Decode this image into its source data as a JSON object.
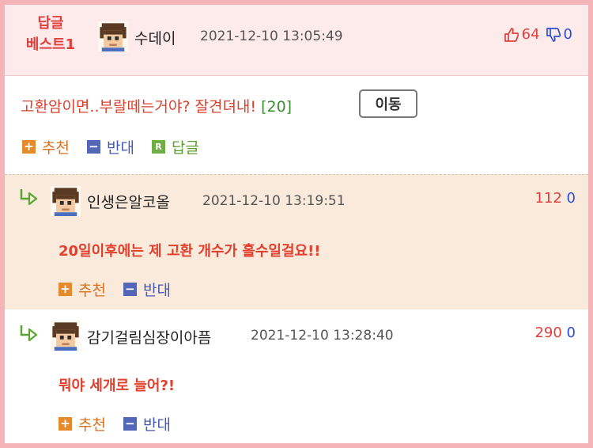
{
  "best": {
    "label_line1": "답글",
    "label_line2": "베스트1",
    "author": "수데이",
    "date": "2021-12-10 13:05:49",
    "upvotes": "64",
    "downvotes": "0",
    "content": "고환암이면..부랄떼는거야? 잘견뎌내! ",
    "reply_count": "[20]",
    "move_label": "이동",
    "recommend_label": "추천",
    "oppose_label": "반대",
    "reply_label": "답글"
  },
  "replies": [
    {
      "author": "인생은알코올",
      "date": "2021-12-10 13:19:51",
      "upvotes": "112",
      "downvotes": "0",
      "content": "20일이후에는 제 고환 개수가 홀수일걸요!!",
      "recommend_label": "추천",
      "oppose_label": "반대"
    },
    {
      "author": "감기걸림심장이아픔",
      "date": "2021-12-10 13:28:40",
      "upvotes": "290",
      "downvotes": "0",
      "content": "뭐야 세개로 늘어?!",
      "recommend_label": "추천",
      "oppose_label": "반대"
    }
  ],
  "icons": {
    "avatar": "pixel-avatar-icon",
    "thumb_up": "thumb-up-icon",
    "thumb_down": "thumb-down-icon",
    "reply_arrow": "reply-arrow-icon",
    "plus": "plus-icon",
    "minus": "minus-icon",
    "reply_badge": "reply-badge-icon"
  },
  "colors": {
    "accent_red": "#e0403c",
    "down_blue": "#2a4fd0",
    "recommend_orange": "#e68a2e",
    "oppose_blue": "#5466b8",
    "reply_green": "#6fae46",
    "frame_pink": "#f4b4b8"
  }
}
